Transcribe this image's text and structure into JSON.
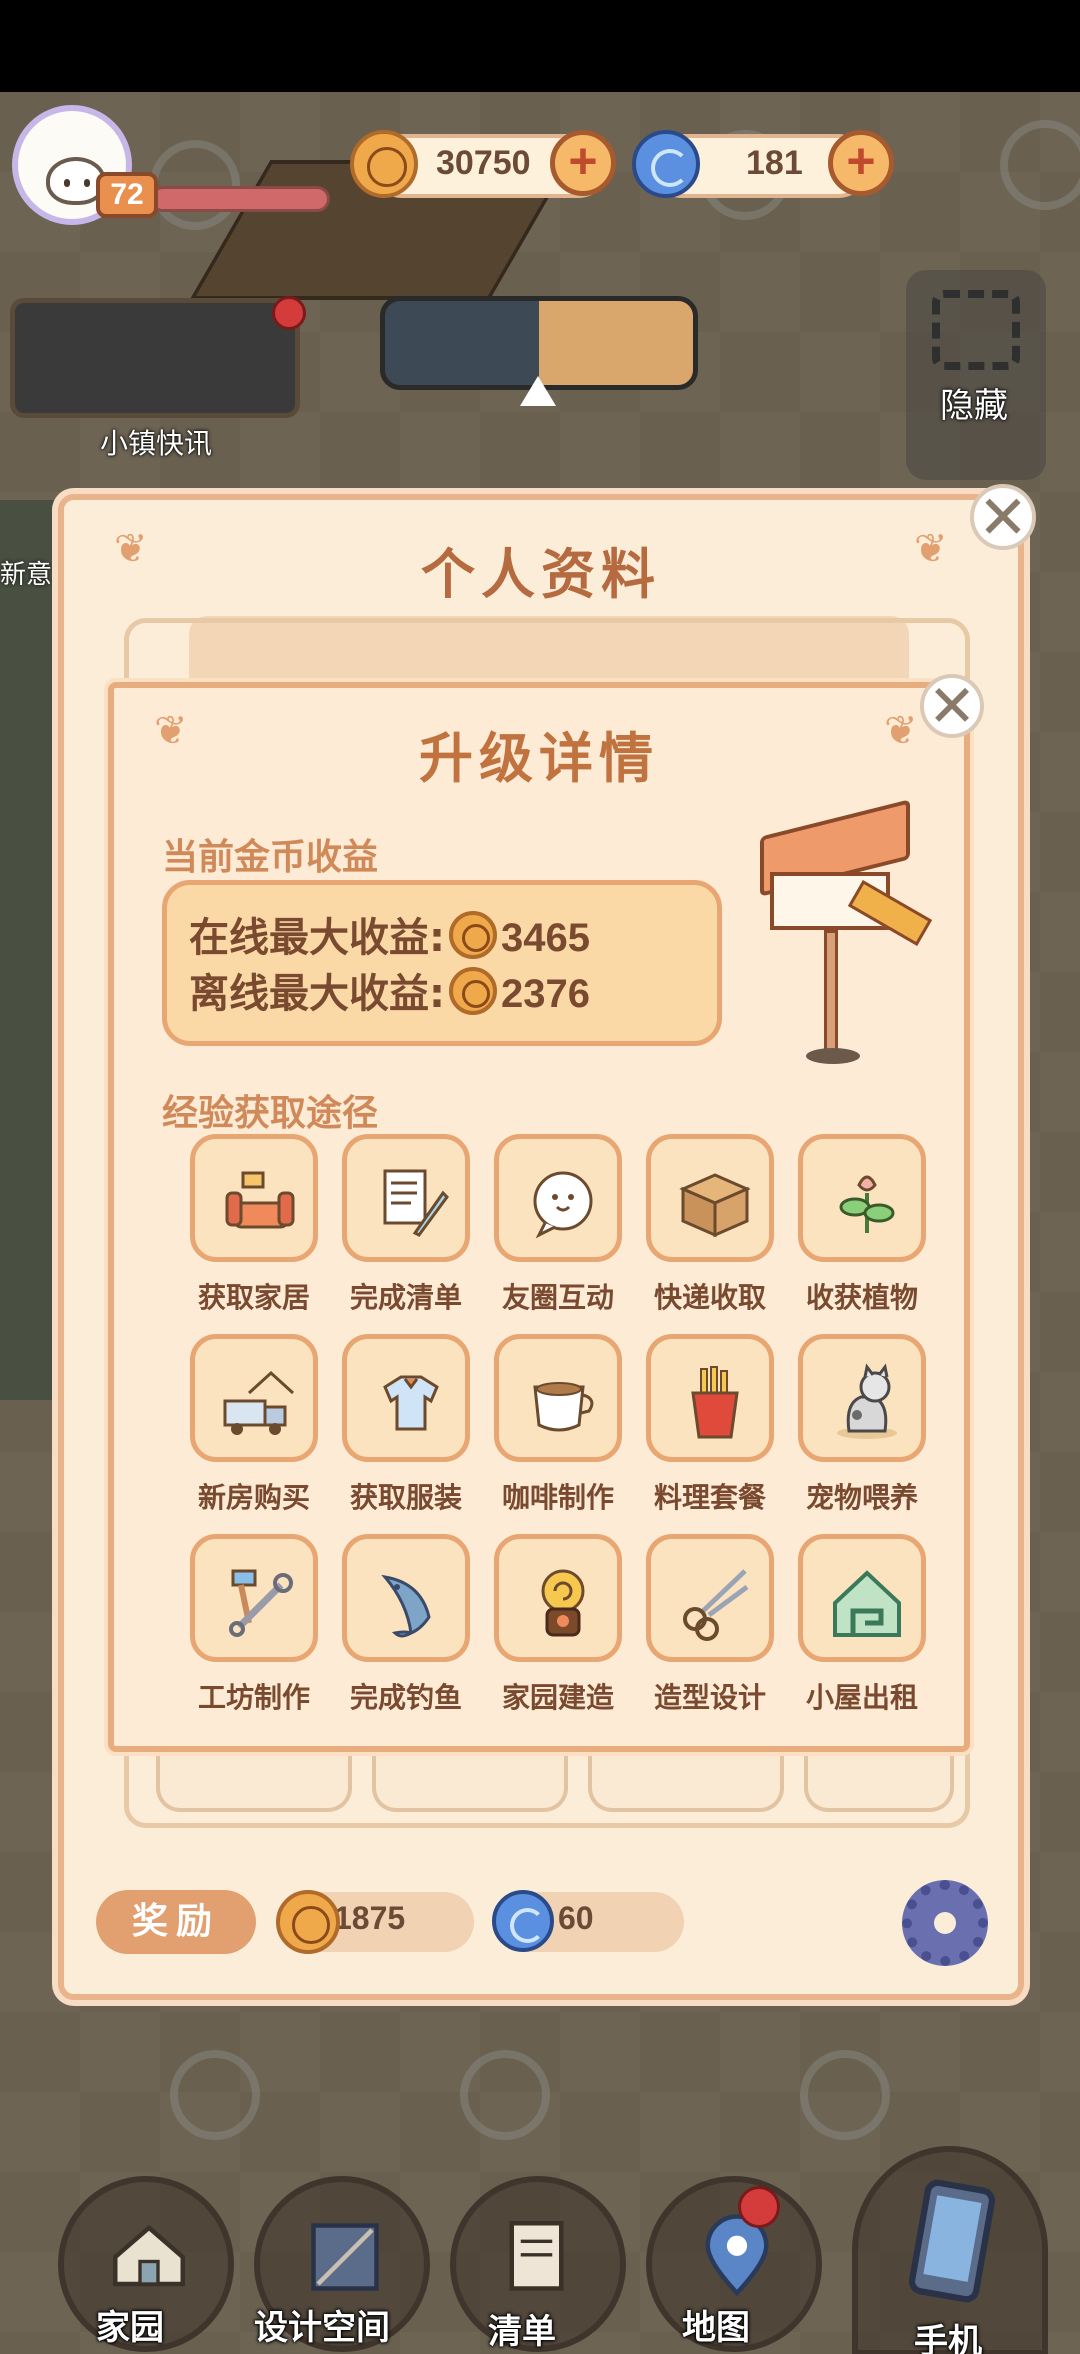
{
  "hud": {
    "level": "72",
    "coins": "30750",
    "gems": "181",
    "plus": "+"
  },
  "side": {
    "news_label": "小镇快讯",
    "left_label": "新意",
    "hide_label": "隐藏"
  },
  "profile": {
    "title": "个人资料",
    "close": "✕",
    "reward_label": "奖励",
    "reward_coins": "1875",
    "reward_gems": "60"
  },
  "modal": {
    "title": "升级详情",
    "close": "✕",
    "income_section": "当前金币收益",
    "online_label": "在线最大收益:",
    "online_value": "3465",
    "offline_label": "离线最大收益:",
    "offline_value": "2376",
    "exp_section": "经验获取途径",
    "items": [
      {
        "label": "获取家居",
        "icon": "sofa-icon"
      },
      {
        "label": "完成清单",
        "icon": "checklist-icon"
      },
      {
        "label": "友圈互动",
        "icon": "chat-bubble-icon"
      },
      {
        "label": "快递收取",
        "icon": "parcel-box-icon"
      },
      {
        "label": "收获植物",
        "icon": "plant-icon"
      },
      {
        "label": "新房购买",
        "icon": "moving-truck-icon"
      },
      {
        "label": "获取服装",
        "icon": "shirt-icon"
      },
      {
        "label": "咖啡制作",
        "icon": "coffee-cup-icon"
      },
      {
        "label": "料理套餐",
        "icon": "fries-icon"
      },
      {
        "label": "宠物喂养",
        "icon": "cat-icon"
      },
      {
        "label": "工坊制作",
        "icon": "tools-icon"
      },
      {
        "label": "完成钓鱼",
        "icon": "fish-icon"
      },
      {
        "label": "家园建造",
        "icon": "snail-house-icon"
      },
      {
        "label": "造型设计",
        "icon": "scissors-icon"
      },
      {
        "label": "小屋出租",
        "icon": "house-key-icon"
      }
    ]
  },
  "nav": {
    "home": "家园",
    "design": "设计空间",
    "list": "清单",
    "map": "地图",
    "phone": "手机"
  }
}
